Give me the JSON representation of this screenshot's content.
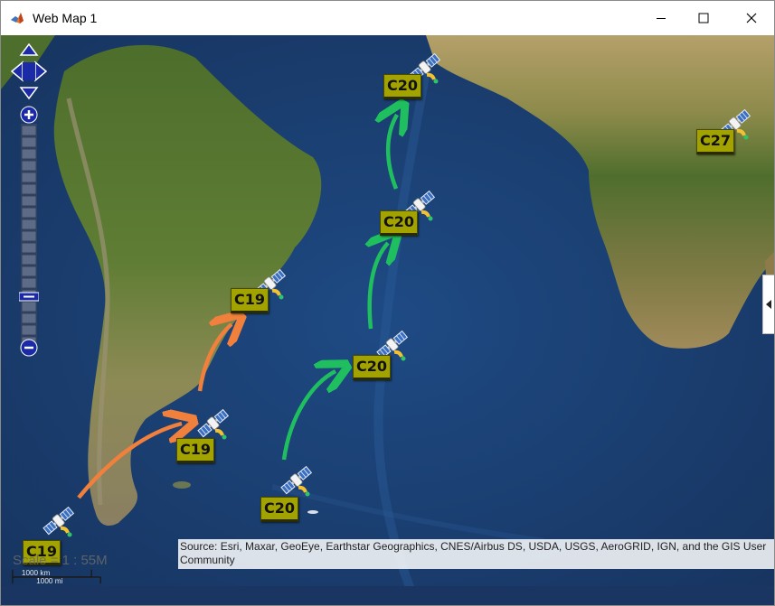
{
  "window": {
    "title": "Web Map 1",
    "icon": "matlab-icon"
  },
  "controls": {
    "minimize_icon": "minimize-icon",
    "maximize_icon": "maximize-icon",
    "close_icon": "close-icon"
  },
  "map": {
    "colors": {
      "ocean": "#1c3f73",
      "land": "#6d8a3a",
      "desert": "#b49a63",
      "label_bg": "#a3a300",
      "arrow_orange": "#f0803c",
      "arrow_green": "#1fbf60",
      "nav_blue": "#1b2aa6"
    },
    "markers": [
      {
        "label": "C19",
        "icon": "satellite-icon"
      },
      {
        "label": "C19",
        "icon": "satellite-icon"
      },
      {
        "label": "C19",
        "icon": "satellite-icon"
      },
      {
        "label": "C20",
        "icon": "satellite-icon"
      },
      {
        "label": "C20",
        "icon": "satellite-icon"
      },
      {
        "label": "C20",
        "icon": "satellite-icon"
      },
      {
        "label": "C20",
        "icon": "satellite-icon"
      },
      {
        "label": "C27",
        "icon": "satellite-icon"
      }
    ],
    "scale": {
      "km": "1000 km",
      "mi": "1000 mi",
      "ratio": "Scale = 1 : 55M"
    },
    "attribution": "Source: Esri, Maxar, GeoEye, Earthstar Geographics, CNES/Airbus DS, USDA, USGS, AeroGRID, IGN, and the GIS User Community"
  }
}
